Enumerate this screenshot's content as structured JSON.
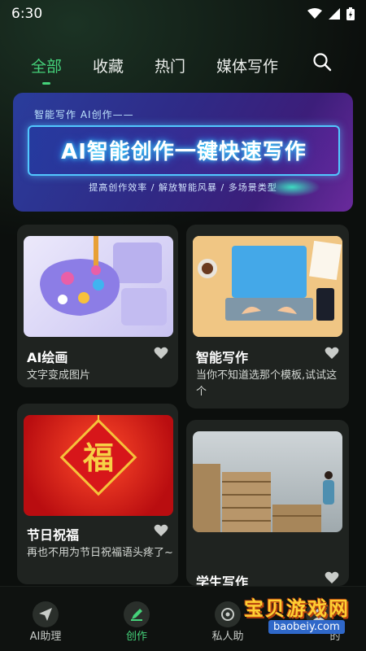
{
  "status": {
    "time": "6:30"
  },
  "tabs": [
    {
      "label": "全部",
      "active": true
    },
    {
      "label": "收藏",
      "active": false
    },
    {
      "label": "热门",
      "active": false
    },
    {
      "label": "媒体写作",
      "active": false
    }
  ],
  "banner": {
    "top_line": "智能写作  AI创作——",
    "headline": "AI智能创作一键快速写作",
    "subline": "提高创作效率 / 解放智能风暴 / 多场景类型"
  },
  "cards": [
    {
      "title": "AI绘画",
      "desc": "文字变成图片",
      "icon": "heart-icon"
    },
    {
      "title": "智能写作",
      "desc": "当你不知道选那个模板,试试这个",
      "icon": "heart-icon"
    },
    {
      "title": "节日祝福",
      "desc": "再也不用为节日祝福语头疼了~",
      "icon": "heart-icon"
    },
    {
      "title": "学生写作",
      "desc": "",
      "icon": "heart-icon"
    }
  ],
  "card_art": {
    "fu_char": "福"
  },
  "bottom_nav": [
    {
      "label": "AI助理",
      "icon": "paper-plane-icon",
      "active": false
    },
    {
      "label": "创作",
      "icon": "pen-icon",
      "active": true
    },
    {
      "label": "私人助",
      "icon": "assistant-icon",
      "active": false
    },
    {
      "label": "的",
      "icon": "user-icon",
      "active": false
    }
  ],
  "watermark": {
    "text": "宝贝游戏网",
    "url": "baobeiy.com"
  },
  "colors": {
    "accent": "#45d27a",
    "background": "#0c0f0d",
    "card": "#1f2320"
  }
}
